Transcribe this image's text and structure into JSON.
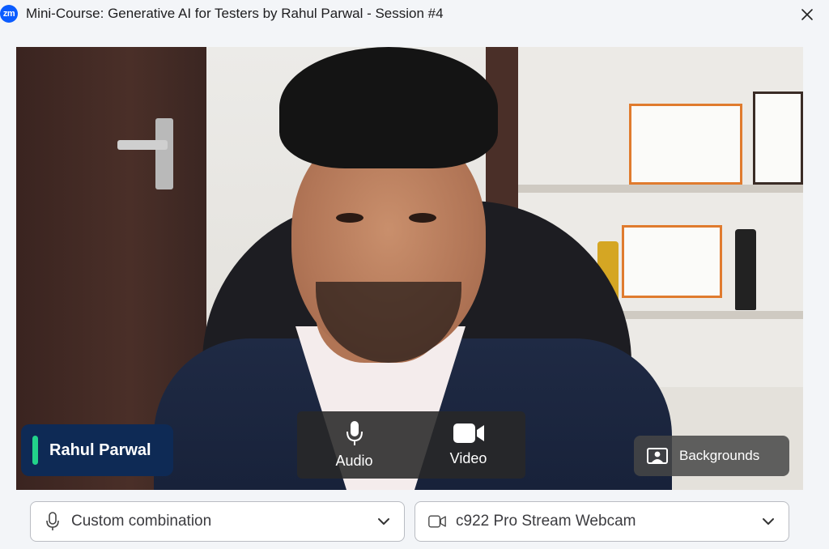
{
  "window": {
    "app_logo_text": "zm",
    "title": "Mini-Course: Generative AI for Testers by Rahul Parwal - Session #4",
    "close_icon": "close-icon"
  },
  "preview": {
    "participant_name": "Rahul Parwal",
    "speaking_indicator_color": "#22d38a",
    "controls": {
      "audio_label": "Audio",
      "video_label": "Video"
    },
    "backgrounds_label": "Backgrounds"
  },
  "devices": {
    "audio_selected": "Custom combination",
    "video_selected": "c922 Pro Stream Webcam"
  },
  "colors": {
    "brand": "#0b5cff",
    "name_tag_bg": "#0e2a55"
  }
}
